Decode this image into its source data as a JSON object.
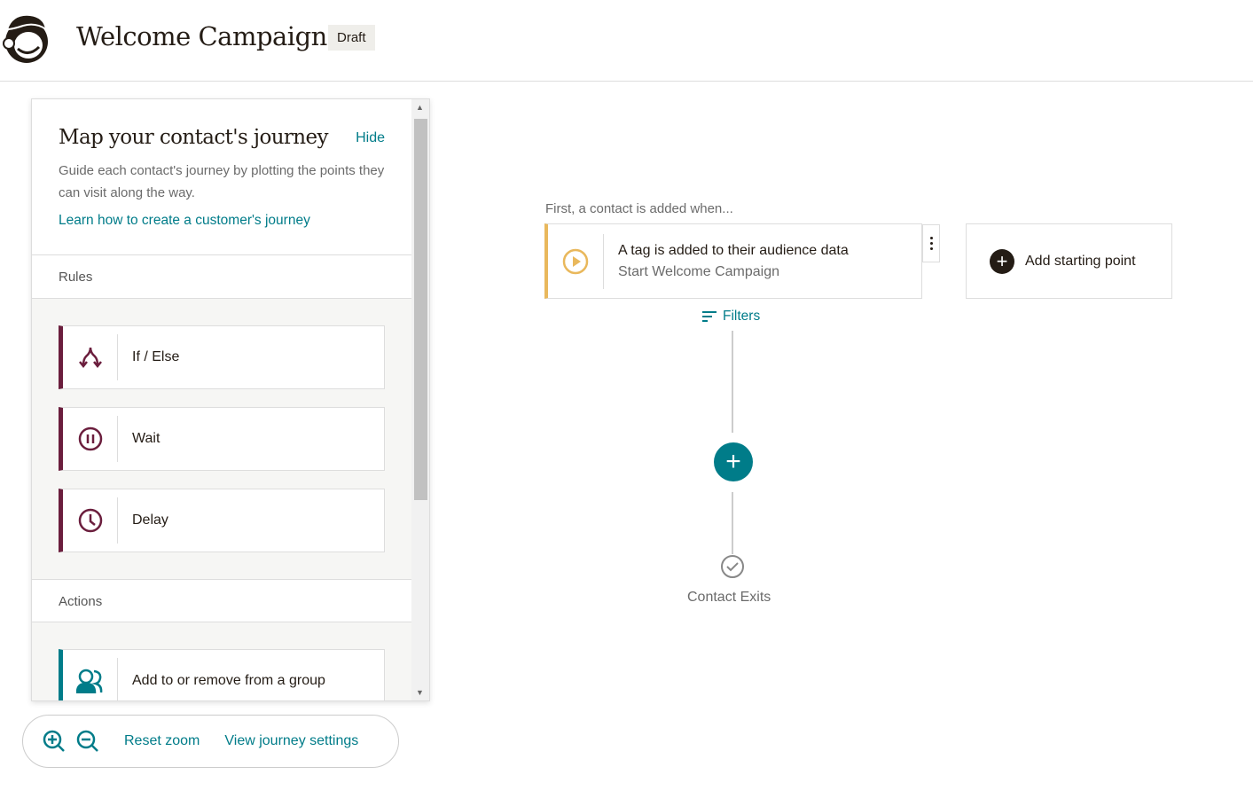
{
  "header": {
    "title": "Welcome Campaign",
    "status": "Draft"
  },
  "panel": {
    "title": "Map your contact's journey",
    "hide": "Hide",
    "description": "Guide each contact's journey by plotting the points they can visit along the way.",
    "learn_link": "Learn how to create a customer's journey",
    "rules_label": "Rules",
    "rules": [
      {
        "label": "If / Else",
        "icon": "split-icon"
      },
      {
        "label": "Wait",
        "icon": "pause-icon"
      },
      {
        "label": "Delay",
        "icon": "clock-icon"
      }
    ],
    "actions_label": "Actions",
    "actions": [
      {
        "label": "Add to or remove from a group",
        "icon": "group-icon"
      }
    ]
  },
  "zoombar": {
    "reset": "Reset zoom",
    "settings": "View journey settings"
  },
  "canvas": {
    "caption": "First, a contact is added when...",
    "trigger_title": "A tag is added to their audience data",
    "trigger_subtitle": "Start Welcome Campaign",
    "add_start": "Add starting point",
    "filters": "Filters",
    "exit": "Contact Exits"
  },
  "colors": {
    "accent": "#007c89",
    "rule": "#6b1e3d",
    "trigger": "#e9b85c"
  }
}
